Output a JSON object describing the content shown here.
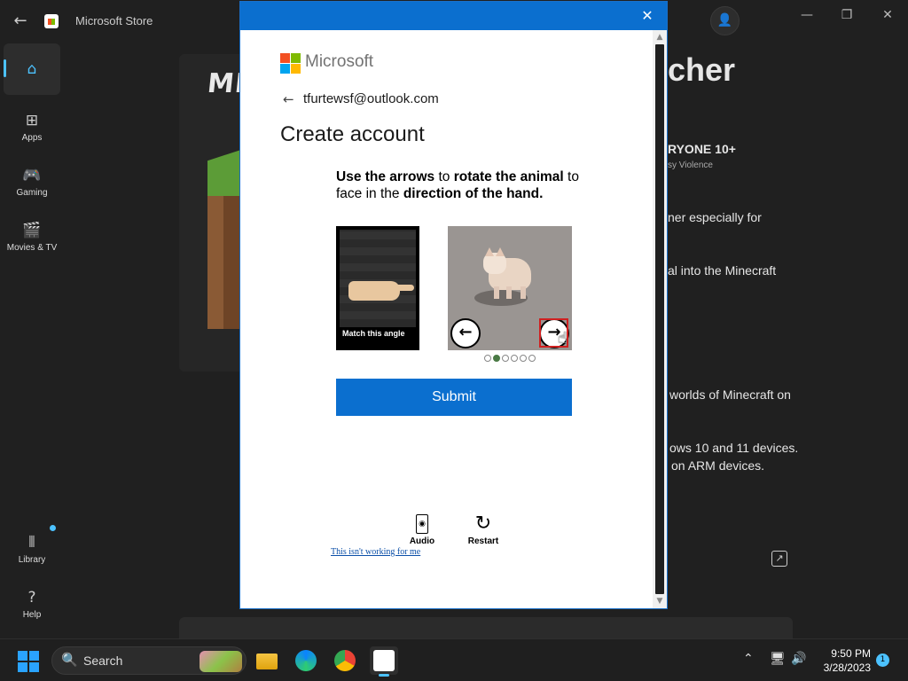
{
  "store": {
    "title": "Microsoft Store",
    "sidebar": [
      {
        "id": "home",
        "label": "Home",
        "icon": "home-icon"
      },
      {
        "id": "apps",
        "label": "Apps",
        "icon": "apps-icon"
      },
      {
        "id": "gaming",
        "label": "Gaming",
        "icon": "gamepad-icon"
      },
      {
        "id": "movies",
        "label": "Movies & TV",
        "icon": "clapperboard-icon"
      },
      {
        "id": "library",
        "label": "Library",
        "icon": "library-icon"
      },
      {
        "id": "help",
        "label": "Help",
        "icon": "help-icon"
      }
    ],
    "background": {
      "hero_logo": "MI",
      "title_partial": "cher",
      "rating": "RYONE 10+",
      "rating_sub": "sy Violence",
      "line1": "ner especially for",
      "line2": "al into the Minecraft",
      "line3": "worlds of Minecraft on",
      "line4": "ows 10 and 11 devices.",
      "line5": "on ARM devices."
    }
  },
  "dialog": {
    "brand": "Microsoft",
    "email": "tfurtewsf@outlook.com",
    "heading": "Create account",
    "instruction": {
      "p1_bold": "Use the arrows",
      "p2": " to ",
      "p3_bold": "rotate the animal",
      "p4": " to face in the ",
      "p5_bold": "direction of the hand."
    },
    "hand_caption": "Match this angle",
    "carousel": {
      "total": 6,
      "current": 2
    },
    "submit": "Submit",
    "audio": "Audio",
    "restart": "Restart",
    "not_working": "This isn't working for me"
  },
  "taskbar": {
    "search": "Search",
    "time": "9:50 PM",
    "date": "3/28/2023",
    "notifications": "1"
  },
  "colors": {
    "accent": "#0b6fcf",
    "store_accent": "#4cc2ff"
  }
}
